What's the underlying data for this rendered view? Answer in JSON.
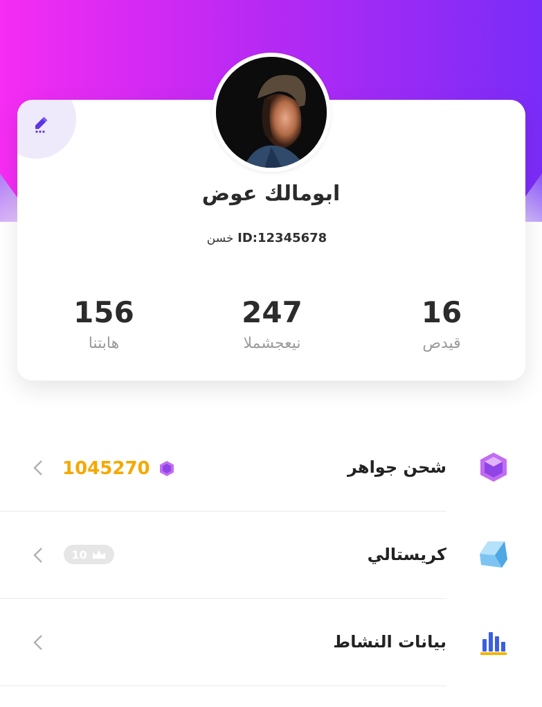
{
  "profile": {
    "name": "ابومالك عوض",
    "id_text": "ID:12345678",
    "bio": "خسن"
  },
  "stats": [
    {
      "value": "156",
      "label": "هابتنا"
    },
    {
      "value": "247",
      "label": "نيعجشملا"
    },
    {
      "value": "16",
      "label": "قيدص"
    }
  ],
  "menu": [
    {
      "title": "شحن جواهر",
      "icon": "gem-icon",
      "value": "1045270"
    },
    {
      "title": "كريستالي",
      "icon": "crystal-icon",
      "badge": "10"
    },
    {
      "title": "بيانات النشاط",
      "icon": "bar-chart-icon"
    }
  ],
  "colors": {
    "gradient_start": "#f62cf3",
    "gradient_end": "#7a2cf8",
    "gem_value": "#f6a800",
    "accent": "#5b35e6"
  }
}
